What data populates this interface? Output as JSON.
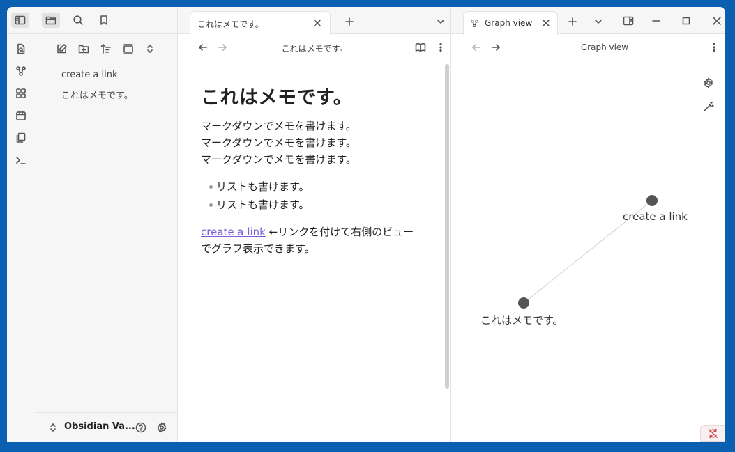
{
  "sidebar": {
    "files": [
      "create a link",
      "これはメモです。"
    ],
    "vault_name": "Obsidian Va..."
  },
  "editor": {
    "tab_title": "これはメモです。",
    "nav_title": "これはメモです。",
    "heading": "これはメモです。",
    "paragraph_lines": [
      "マークダウンでメモを書けます。",
      "マークダウンでメモを書けます。",
      "マークダウンでメモを書けます。"
    ],
    "bullets": [
      "リストも書けます。",
      "リストも書けます。"
    ],
    "link_text": "create a link",
    "link_tail_1": " ←リンクを付けて右側のビュー",
    "link_tail_2": "でグラフ表示できます。"
  },
  "graph": {
    "tab_title": "Graph view",
    "nav_title": "Graph view",
    "nodes": [
      "create a link",
      "これはメモです。"
    ]
  },
  "colors": {
    "accent_link": "#7a5fd6",
    "node": "#555555",
    "desktop": "#0a5fb0"
  }
}
